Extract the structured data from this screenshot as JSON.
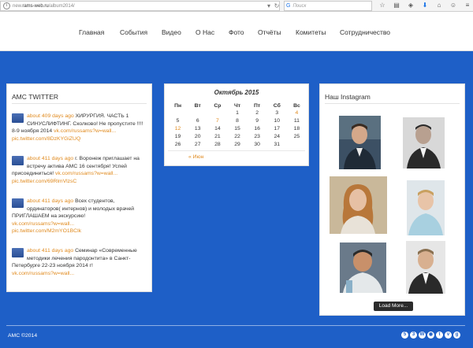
{
  "browser": {
    "url_prefix": "new.",
    "url_domain": "rams-web.ru",
    "url_path": "/album2014/",
    "search_placeholder": "Поиск"
  },
  "nav": {
    "items": [
      "Главная",
      "События",
      "Видео",
      "О Нас",
      "Фото",
      "Отчёты",
      "Комитеты",
      "Сотрудничество"
    ]
  },
  "twitter": {
    "title": "АМС TWITTER",
    "tweets": [
      {
        "time": "about 409 days ago",
        "text": "ХИРУРГИЯ. ЧАСТЬ 1 СИНУСЛИФТИНГ. Сколково! Не пропустите !!!! 8-9 ноября 2014",
        "link1": "vk.com/russams?w=wall...",
        "link2": "pic.twitter.com/8DzKYGiZUQ"
      },
      {
        "time": "about 411 days ago",
        "text": "г. Воронеж приглашает на встречу актива АМС 16 сентября! Успей присоединиться!",
        "link1": "vk.com/russams?w=wall...",
        "link2": "pic.twitter.com/69RlmVlzsC"
      },
      {
        "time": "about 411 days ago",
        "text": "Всех студентов, ординаторов( интернов) и молодых врачей ПРИГЛАШАЕМ на экскурсию!",
        "link1": "vk.com/russams?w=wall...",
        "link2": "pic.twitter.com/M2mYO1BClk"
      },
      {
        "time": "about 411 days ago",
        "text": "Семинар «Современные методики лечения пародонтита» в Санкт-Петербурге 22-23 ноября 2014 г!",
        "link1": "vk.com/russams?w=wall...",
        "link2": ""
      }
    ]
  },
  "calendar": {
    "title": "Октябрь 2015",
    "weekdays": [
      "Пн",
      "Вт",
      "Ср",
      "Чт",
      "Пт",
      "Сб",
      "Вс"
    ],
    "weeks": [
      [
        "",
        "",
        "",
        "1",
        "2",
        "3",
        "4"
      ],
      [
        "5",
        "6",
        "7",
        "8",
        "9",
        "10",
        "11"
      ],
      [
        "12",
        "13",
        "14",
        "15",
        "16",
        "17",
        "18"
      ],
      [
        "19",
        "20",
        "21",
        "22",
        "23",
        "24",
        "25"
      ],
      [
        "26",
        "27",
        "28",
        "29",
        "30",
        "31",
        ""
      ]
    ],
    "highlighted": [
      "4",
      "7",
      "12"
    ],
    "prev_label": "« Июн"
  },
  "instagram": {
    "title": "Наш Instagram",
    "load_more": "Load More..."
  },
  "footer": {
    "copyright": "АМС ©2014",
    "icons": [
      "html5-icon",
      "css3-icon",
      "wordpress-icon",
      "rss-icon",
      "twitter-icon",
      "vk-icon",
      "g-icon"
    ]
  },
  "colors": {
    "brand_blue": "#1e5fc7",
    "accent_orange": "#e08a1e"
  }
}
